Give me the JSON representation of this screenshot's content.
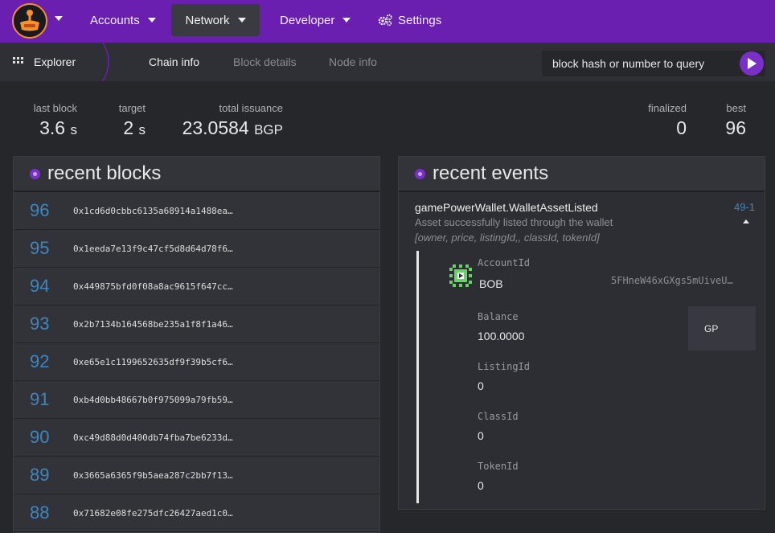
{
  "nav": {
    "items": [
      {
        "label": "Accounts",
        "has_caret": true
      },
      {
        "label": "Network",
        "has_caret": true,
        "active": true
      },
      {
        "label": "Developer",
        "has_caret": true
      },
      {
        "label": "Settings",
        "icon": "gears-icon"
      }
    ]
  },
  "subnav": {
    "section": "Explorer",
    "tabs": [
      {
        "label": "Chain info",
        "active": true
      },
      {
        "label": "Block details"
      },
      {
        "label": "Node info"
      }
    ],
    "query_placeholder": "block hash or number to query"
  },
  "stats": {
    "last_block": {
      "label": "last block",
      "value": "3.6",
      "unit": "s"
    },
    "target": {
      "label": "target",
      "value": "2",
      "unit": "s"
    },
    "total_issuance": {
      "label": "total issuance",
      "value": "23.0584",
      "unit": "BGP"
    },
    "finalized": {
      "label": "finalized",
      "value": "0"
    },
    "best": {
      "label": "best",
      "value": "96"
    }
  },
  "recent_blocks": {
    "title": "recent blocks",
    "rows": [
      {
        "number": "96",
        "hash": "0x1cd6d0cbbc6135a68914a1488ea…"
      },
      {
        "number": "95",
        "hash": "0x1eeda7e13f9c47cf5d8d64d78f6…"
      },
      {
        "number": "94",
        "hash": "0x449875bfd0f08a8ac9615f647cc…"
      },
      {
        "number": "93",
        "hash": "0x2b7134b164568be235a1f8f1a46…"
      },
      {
        "number": "92",
        "hash": "0xe65e1c1199652635df9f39b5cf6…"
      },
      {
        "number": "91",
        "hash": "0xb4d0bb48667b0f975099a79fb59…"
      },
      {
        "number": "90",
        "hash": "0xc49d88d0d400db74fba7be6233d…"
      },
      {
        "number": "89",
        "hash": "0x3665a6365f9b5aea287c2bb7f13…"
      },
      {
        "number": "88",
        "hash": "0x71682e08fe275dfc26427aed1c0…"
      }
    ]
  },
  "recent_events": {
    "title": "recent events",
    "event": {
      "name": "gamePowerWallet.WalletAssetListed",
      "description": "Asset successfully listed through the wallet",
      "args": "[owner, price, listingId,, classId, tokenId]",
      "id": "49-1",
      "params": {
        "account": {
          "label": "AccountId",
          "name": "BOB",
          "address": "5FHneW46xGXgs5mUiveU…"
        },
        "balance": {
          "label": "Balance",
          "value": "100.0000",
          "unit": "GP"
        },
        "listing": {
          "label": "ListingId",
          "value": "0"
        },
        "class": {
          "label": "ClassId",
          "value": "0"
        },
        "token": {
          "label": "TokenId",
          "value": "0"
        }
      }
    }
  },
  "colors": {
    "topbar": "#6a1fb0",
    "accent": "#7a2fc9",
    "block_number": "#3e86c0",
    "background": "#26272b"
  }
}
